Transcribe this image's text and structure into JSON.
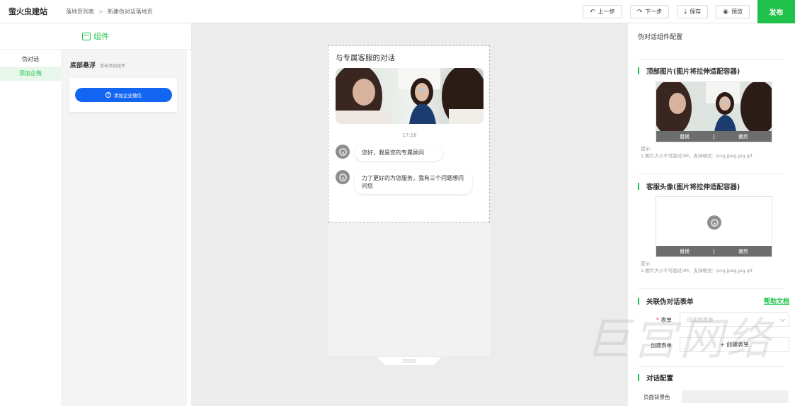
{
  "topbar": {
    "brand": "萤火虫建站",
    "breadcrumbs": [
      "落地页列表",
      "新建伪对话落地页"
    ],
    "breadcrumb_sep": ">",
    "undo_label": "上一步",
    "redo_label": "下一步",
    "save_label": "保存",
    "preview_label": "预览",
    "publish_label": "发布",
    "accent_color": "#1ec24a"
  },
  "left_panel": {
    "header_label": "组件",
    "categories": [
      {
        "label": "伪对话",
        "active": false
      },
      {
        "label": "添加企微",
        "active": true
      }
    ],
    "section_title": "底部悬浮",
    "section_subtitle": "单击添加组件",
    "add_button_label": "添加企业微信",
    "button_color": "#1266f1"
  },
  "canvas": {
    "chat_title": "与专属客服的对话",
    "time": "17:16",
    "messages": [
      {
        "text": "您好，我是您的专属顾问"
      },
      {
        "text": "力了更好的为您服务，我有三个问题想问问您"
      }
    ]
  },
  "right_panel": {
    "title": "伪对话组件配置",
    "top_image": {
      "title": "顶部图片(图片将拉伸适配容器)",
      "replace_label": "替换",
      "crop_label": "裁剪",
      "pipe": "|",
      "hint_title": "提示:",
      "hint_text": "1.图片大小不可超过3M，支持格式：png,jpeg,jpg,gif"
    },
    "avatar_image": {
      "title": "客服头像(图片将拉伸适配容器)",
      "replace_label": "替换",
      "crop_label": "裁剪",
      "pipe": "|",
      "hint_title": "提示:",
      "hint_text": "1.图片大小不可超过3M，支持格式：png,jpeg,jpg,gif"
    },
    "form_section": {
      "title": "关联伪对话表单",
      "help_link": "帮助文档",
      "form_label": "表单",
      "required_mark": "*",
      "form_placeholder": "请选择表单",
      "create_label": "创建表单",
      "create_button_label": "+ 创建表单"
    },
    "dialog_section": {
      "title": "对话配置",
      "bg_color_label": "页面背景色"
    }
  },
  "watermark": "巨宫网络"
}
